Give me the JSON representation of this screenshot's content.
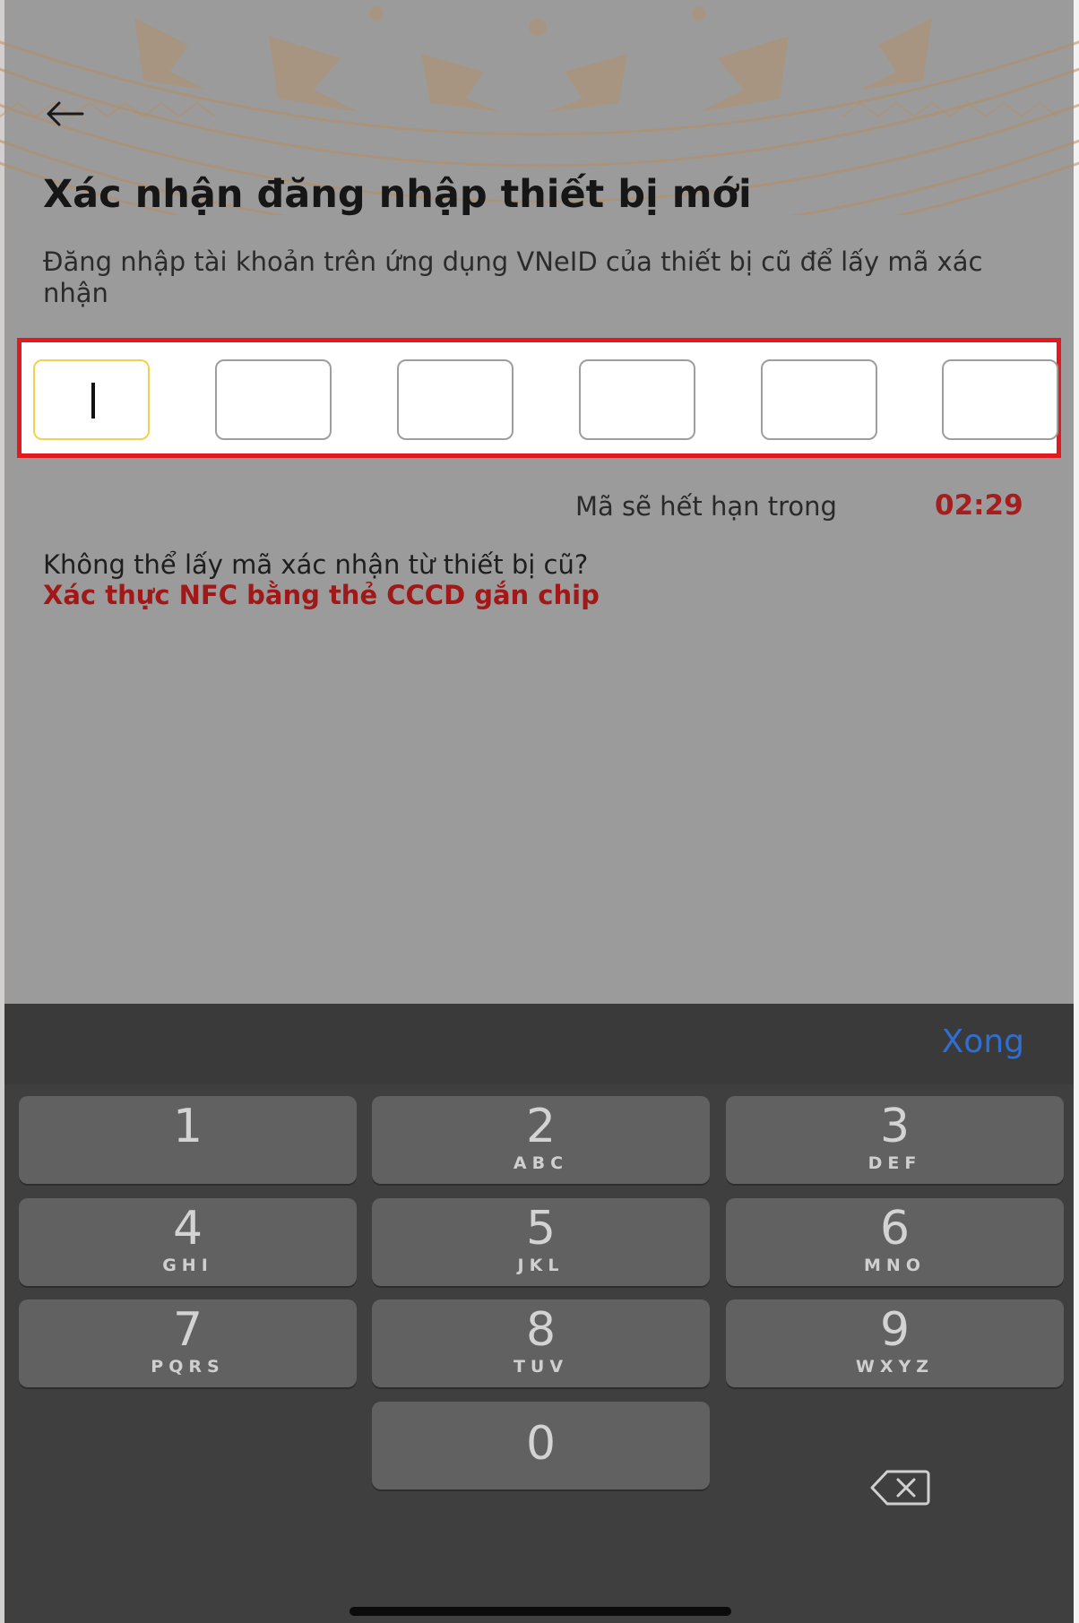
{
  "header": {
    "title": "Xác nhận đăng nhập thiết bị mới",
    "subtitle": "Đăng nhập tài khoản trên ứng dụng VNeID của thiết bị cũ để lấy mã xác nhận"
  },
  "otp": {
    "digits": [
      "",
      "",
      "",
      "",
      "",
      ""
    ]
  },
  "expiry": {
    "label": "Mã sẽ hết hạn trong",
    "time": "02:29"
  },
  "help": {
    "question": "Không thể lấy mã xác nhận từ thiết bị cũ?",
    "link": "Xác thực NFC bằng thẻ CCCD gắn chip"
  },
  "keyboard": {
    "done_label": "Xong",
    "keys": [
      {
        "digit": "1",
        "letters": ""
      },
      {
        "digit": "2",
        "letters": "ABC"
      },
      {
        "digit": "3",
        "letters": "DEF"
      },
      {
        "digit": "4",
        "letters": "GHI"
      },
      {
        "digit": "5",
        "letters": "JKL"
      },
      {
        "digit": "6",
        "letters": "MNO"
      },
      {
        "digit": "7",
        "letters": "PQRS"
      },
      {
        "digit": "8",
        "letters": "TUV"
      },
      {
        "digit": "9",
        "letters": "WXYZ"
      },
      {
        "digit": "0",
        "letters": ""
      }
    ]
  },
  "colors": {
    "accent_red": "#a51d1d",
    "highlight_border": "#e01a20",
    "active_box": "#f2d24a",
    "done_blue": "#2f6fd1"
  },
  "icons": {
    "back": "arrow-left-icon",
    "delete": "backspace-icon"
  }
}
